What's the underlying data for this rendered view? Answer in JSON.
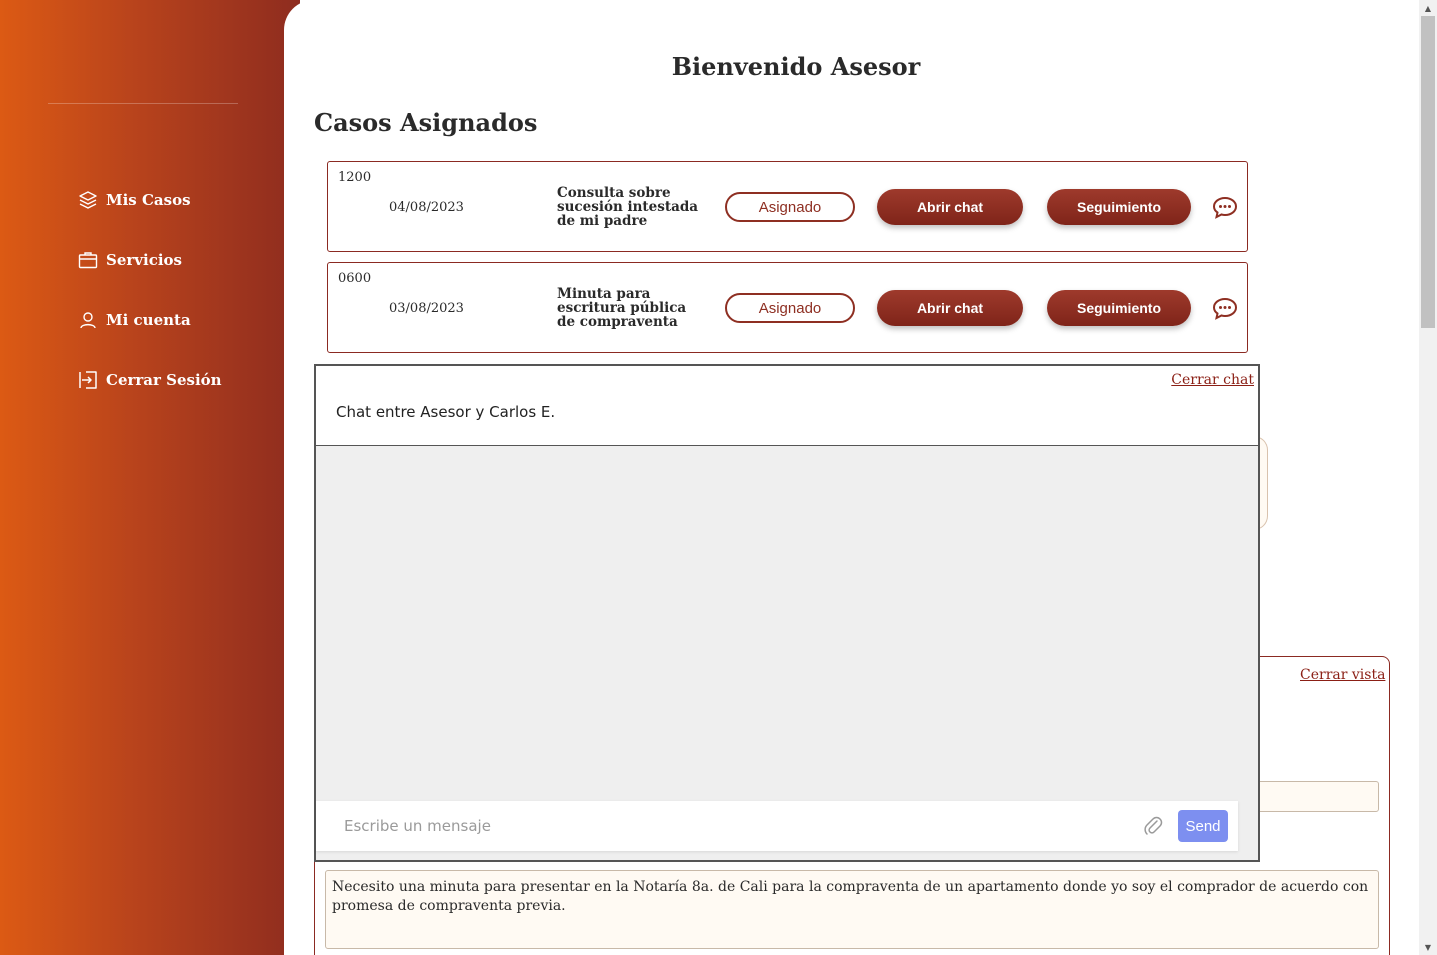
{
  "sidebar": {
    "items": [
      {
        "label": "Mis Casos",
        "icon": "layers-icon"
      },
      {
        "label": "Servicios",
        "icon": "briefcase-icon"
      },
      {
        "label": "Mi cuenta",
        "icon": "user-icon"
      },
      {
        "label": "Cerrar Sesión",
        "icon": "logout-icon"
      }
    ]
  },
  "main": {
    "welcome": "Bienvenido Asesor",
    "section_title": "Casos Asignados",
    "cases": [
      {
        "id": "1200",
        "date": "04/08/2023",
        "description": "Consulta sobre sucesión intestada de mi padre",
        "status": "Asignado",
        "open_chat_label": "Abrir chat",
        "follow_label": "Seguimiento"
      },
      {
        "id": "0600",
        "date": "03/08/2023",
        "description": "Minuta para escritura pública de compraventa",
        "status": "Asignado",
        "open_chat_label": "Abrir chat",
        "follow_label": "Seguimiento"
      }
    ]
  },
  "chat": {
    "close_label": "Cerrar chat",
    "title": "Chat entre Asesor y Carlos E.",
    "input_placeholder": "Escribe un mensaje",
    "input_value": "",
    "send_label": "Send"
  },
  "detail": {
    "close_label": "Cerrar vista",
    "description_text": "Necesito una minuta para presentar en la Notaría 8a. de Cali para la compraventa de un apartamento donde yo soy el comprador de acuerdo con promesa de compraventa previa."
  },
  "colors": {
    "sidebar_start": "#dc5a14",
    "sidebar_end": "#8e2c1f",
    "accent": "#8e2f22",
    "send_button": "#7d8ff0"
  }
}
